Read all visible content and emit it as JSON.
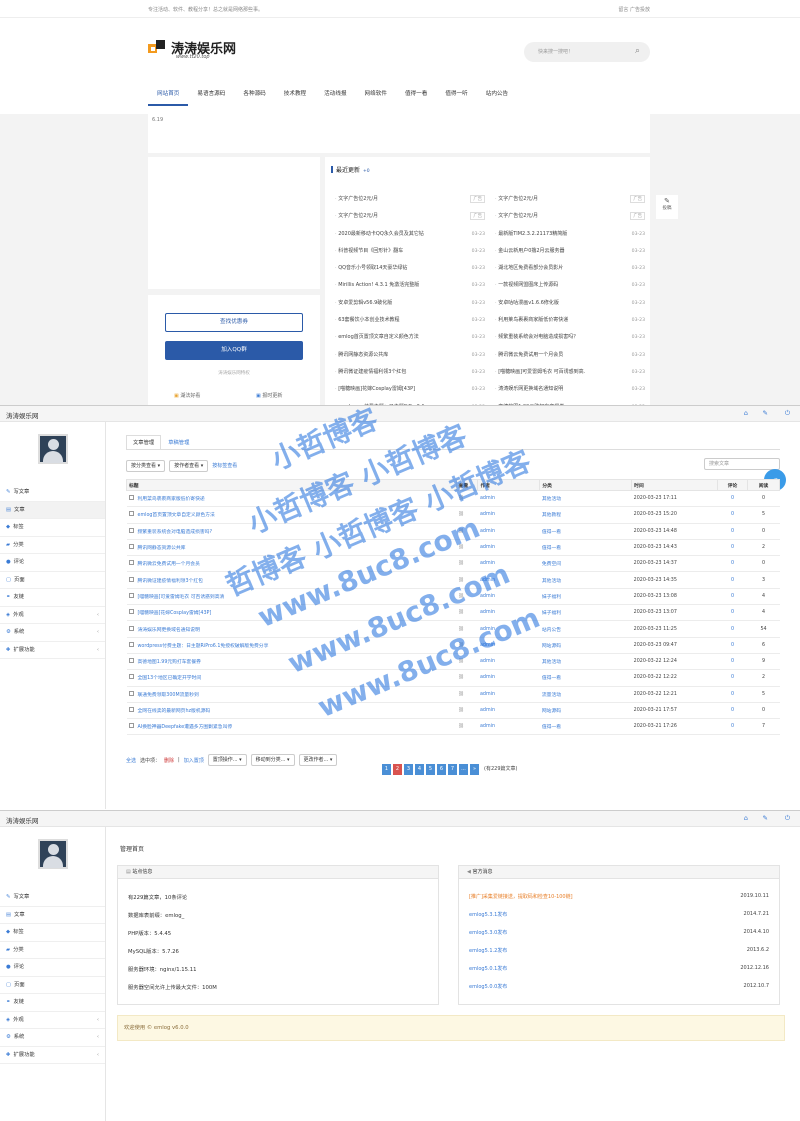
{
  "site": {
    "top_left": "专注活动、软件、教程分享！总之就是网络那些事。",
    "top_right": "留言  广告投放",
    "logo_name": "涛涛娱乐网",
    "logo_url": "www.tt20.top",
    "search_placeholder": "快来搜一搜吧！",
    "nav": [
      "网站首页",
      "易语言源码",
      "各种源码",
      "技术教程",
      "活动线报",
      "网络软件",
      "值得一看",
      "值得一听",
      "站内公告"
    ],
    "banner_alt": "6.19",
    "btn_coupon": "查找优惠券",
    "btn_qq": "加入QQ群",
    "privilege": "涛涛娱乐网特权",
    "mini1": "湖法好看",
    "mini2": "报时更新",
    "news_title": "最近更新",
    "news_count": "+0",
    "submit": "投稿",
    "news_left": [
      {
        "t": "文字广告位2元/月",
        "d": "广告",
        "ad": true
      },
      {
        "t": "文字广告位2元/月",
        "d": "广告",
        "ad": true
      },
      {
        "t": "2020最新移动卡QQ永久会员及其它钻",
        "d": "03-23"
      },
      {
        "t": "科普视频节目《回形针》翻车",
        "d": "03-23"
      },
      {
        "t": "QQ音乐小号领取14天豪华绿钻",
        "d": "03-23"
      },
      {
        "t": "Mirillis Action! 4.3.1 免激活完整版",
        "d": "03-23"
      },
      {
        "t": "安卓爱剪辑v56.9破化版",
        "d": "03-23"
      },
      {
        "t": "63套餐饮小本创业技术教程",
        "d": "03-23"
      },
      {
        "t": "emlog首页置顶文章自定义颜色方法",
        "d": "03-23"
      },
      {
        "t": "腾讯网静态资源公共库",
        "d": "03-23"
      },
      {
        "t": "腾讯微证建疫情福利领3个红包",
        "d": "03-23"
      },
      {
        "t": "[喵糖映画]花嫁Cosplay雷姆[43P]",
        "d": "03-23"
      },
      {
        "t": "wordpress付费主题：日主题RiPro6.1.",
        "d": "03-23"
      }
    ],
    "news_right": [
      {
        "t": "文字广告位2元/月",
        "d": "广告",
        "ad": true
      },
      {
        "t": "文字广告位2元/月",
        "d": "广告",
        "ad": true
      },
      {
        "t": "最新版TIM2.3.2.21173精简版",
        "d": "03-23"
      },
      {
        "t": "金山云新用户0撸2月云服务器",
        "d": "03-23"
      },
      {
        "t": "湖北地区免费看部分会员影片",
        "d": "03-23"
      },
      {
        "t": "一款视频网盟图床上传源码",
        "d": "03-23"
      },
      {
        "t": "安卓咕咕漫画v1.6.6修化版",
        "d": "03-23"
      },
      {
        "t": "利用莱鸟裹裹商家版低价寄快递",
        "d": "03-23"
      },
      {
        "t": "频繁重装系统会对电脑造成损害吗？",
        "d": "03-23"
      },
      {
        "t": "腾讯微云免费试用一个月会员",
        "d": "03-23"
      },
      {
        "t": "[喵糖映画]可爱雷姆毛衣 可百诱惑到高.",
        "d": "03-23"
      },
      {
        "t": "涛涛娱乐网更换域名通知说明",
        "d": "03-23"
      },
      {
        "t": "高德地图1.99元购打车套餐券",
        "d": "03-22"
      }
    ]
  },
  "admin": {
    "title": "涛涛娱乐网",
    "menu": [
      {
        "icon": "✎",
        "label": "写文章",
        "chev": false
      },
      {
        "icon": "▤",
        "label": "文章",
        "chev": false
      },
      {
        "icon": "◆",
        "label": "标签",
        "chev": false
      },
      {
        "icon": "▰",
        "label": "分类",
        "chev": false
      },
      {
        "icon": "●",
        "label": "评论",
        "chev": false
      },
      {
        "icon": "▢",
        "label": "页面",
        "chev": false
      },
      {
        "icon": "⚭",
        "label": "友链",
        "chev": false
      },
      {
        "icon": "◈",
        "label": "外观",
        "chev": true
      },
      {
        "icon": "⚙",
        "label": "系统",
        "chev": true
      },
      {
        "icon": "✚",
        "label": "扩展功能",
        "chev": true
      }
    ]
  },
  "articles": {
    "tab_manage": "文章管理",
    "tab_draft": "草稿管理",
    "filter_cat": "按分类查看",
    "filter_author": "按作者查看",
    "filter_tag": "按标签查看",
    "search_placeholder": "搜索文章",
    "cols": {
      "title": "标题",
      "view": "查看",
      "author": "作者",
      "cat": "分类",
      "time": "时间",
      "comments": "评论",
      "views": "阅读"
    },
    "rows": [
      {
        "t": "利用菜鸟裹裹商家版低价寄快递",
        "a": "admin",
        "c": "其他活动",
        "time": "2020-03-23 17:11",
        "cm": "0",
        "v": "0"
      },
      {
        "t": "emlog首页置顶文章自定义颜色方法",
        "a": "admin",
        "c": "其他教程",
        "time": "2020-03-23 15:20",
        "cm": "0",
        "v": "5"
      },
      {
        "t": "频繁重装系统会对电脑造成损害吗?",
        "a": "admin",
        "c": "值得一看",
        "time": "2020-03-23 14:48",
        "cm": "0",
        "v": "0"
      },
      {
        "t": "腾讯网静态资源公共库",
        "a": "admin",
        "c": "值得一看",
        "time": "2020-03-23 14:43",
        "cm": "0",
        "v": "2"
      },
      {
        "t": "腾讯微云免费试用一个月会员",
        "a": "admin",
        "c": "免费空间",
        "time": "2020-03-23 14:37",
        "cm": "0",
        "v": "0"
      },
      {
        "t": "腾讯微证建疫情福利领3个红包",
        "a": "admin",
        "c": "其他活动",
        "time": "2020-03-23 14:35",
        "cm": "0",
        "v": "3"
      },
      {
        "t": "[喵糖映画]可爱雷姆毛衣 可百诱惑到高清",
        "a": "admin",
        "c": "妹子福利",
        "time": "2020-03-23 13:08",
        "cm": "0",
        "v": "4"
      },
      {
        "t": "[喵糖映画]花嫁Cosplay雷姆[43P]",
        "a": "admin",
        "c": "妹子福利",
        "time": "2020-03-23 13:07",
        "cm": "0",
        "v": "4"
      },
      {
        "t": "涛涛娱乐网更换域名通知说明",
        "a": "admin",
        "c": "站内公告",
        "time": "2020-03-23 11:25",
        "cm": "0",
        "v": "54"
      },
      {
        "t": "wordpress付费主题：日主题RiPro6.1免授权破解版免费分享",
        "a": "admin",
        "c": "网站源码",
        "time": "2020-03-23 09:47",
        "cm": "0",
        "v": "6"
      },
      {
        "t": "高德地图1.99元购打车套餐券",
        "a": "admin",
        "c": "其他活动",
        "time": "2020-03-22 12:24",
        "cm": "0",
        "v": "9"
      },
      {
        "t": "全国13个地区已确定开学时间",
        "a": "admin",
        "c": "值得一看",
        "time": "2020-03-22 12:22",
        "cm": "0",
        "v": "2"
      },
      {
        "t": "联通免费领取300M流量秒到",
        "a": "admin",
        "c": "流量活动",
        "time": "2020-03-22 12:21",
        "cm": "0",
        "v": "5"
      },
      {
        "t": "全网在线卖的最新网页hz版机源码",
        "a": "admin",
        "c": "网站源码",
        "time": "2020-03-21 17:57",
        "cm": "0",
        "v": "0"
      },
      {
        "t": "AI换脸神器Deepfake遭遇多方围剿紧急叫停",
        "a": "admin",
        "c": "值得一看",
        "time": "2020-03-21 17:26",
        "cm": "0",
        "v": "7"
      }
    ],
    "bulk_all": "全选",
    "bulk_selected": "选中项：",
    "bulk_delete": "删除",
    "bulk_top": "加入置顶",
    "op1": "置顶操作...",
    "op2": "移动到分类...",
    "op3": "更改作者...",
    "pages": [
      "1",
      "2",
      "3",
      "4",
      "5",
      "6",
      "7",
      "...",
      "»"
    ],
    "current_page": "2",
    "total": "(有229篇文章)"
  },
  "dashboard": {
    "page_title": "管理首页",
    "site_info_title": "站点信息",
    "articles_line": "有229篇文章，10条评论",
    "db_prefix": "数据库表前缀：emlog_",
    "php": "PHP版本：5.4.45",
    "mysql": "MySQL版本：5.7.26",
    "server": "服务器环境：nginx/1.15.11",
    "upload": "服务器空间允许上传最大文件：100M",
    "official_title": "官方消息",
    "official": [
      {
        "t": "[推广]采集爱链接送，提取码和检查10-100链]",
        "d": "2019.10.11",
        "red": true
      },
      {
        "t": "emlog5.3.1发布",
        "d": "2014.7.21",
        "red": false
      },
      {
        "t": "emlog5.3.0发布",
        "d": "2014.4.10",
        "red": false
      },
      {
        "t": "emlog5.1.2发布",
        "d": "2013.6.2",
        "red": false
      },
      {
        "t": "emlog5.0.1发布",
        "d": "2012.12.16",
        "red": false
      },
      {
        "t": "emlog5.0.0发布",
        "d": "2012.10.7",
        "red": false
      }
    ],
    "footer": "欢迎使用 © emlog v6.0.0"
  },
  "watermark": [
    "小哲博客",
    "小哲博客 小哲博客",
    "哲博客 小哲博客 小哲博客",
    "www.8uc8.com",
    "www.8uc8.com",
    "www.8uc8.com"
  ]
}
